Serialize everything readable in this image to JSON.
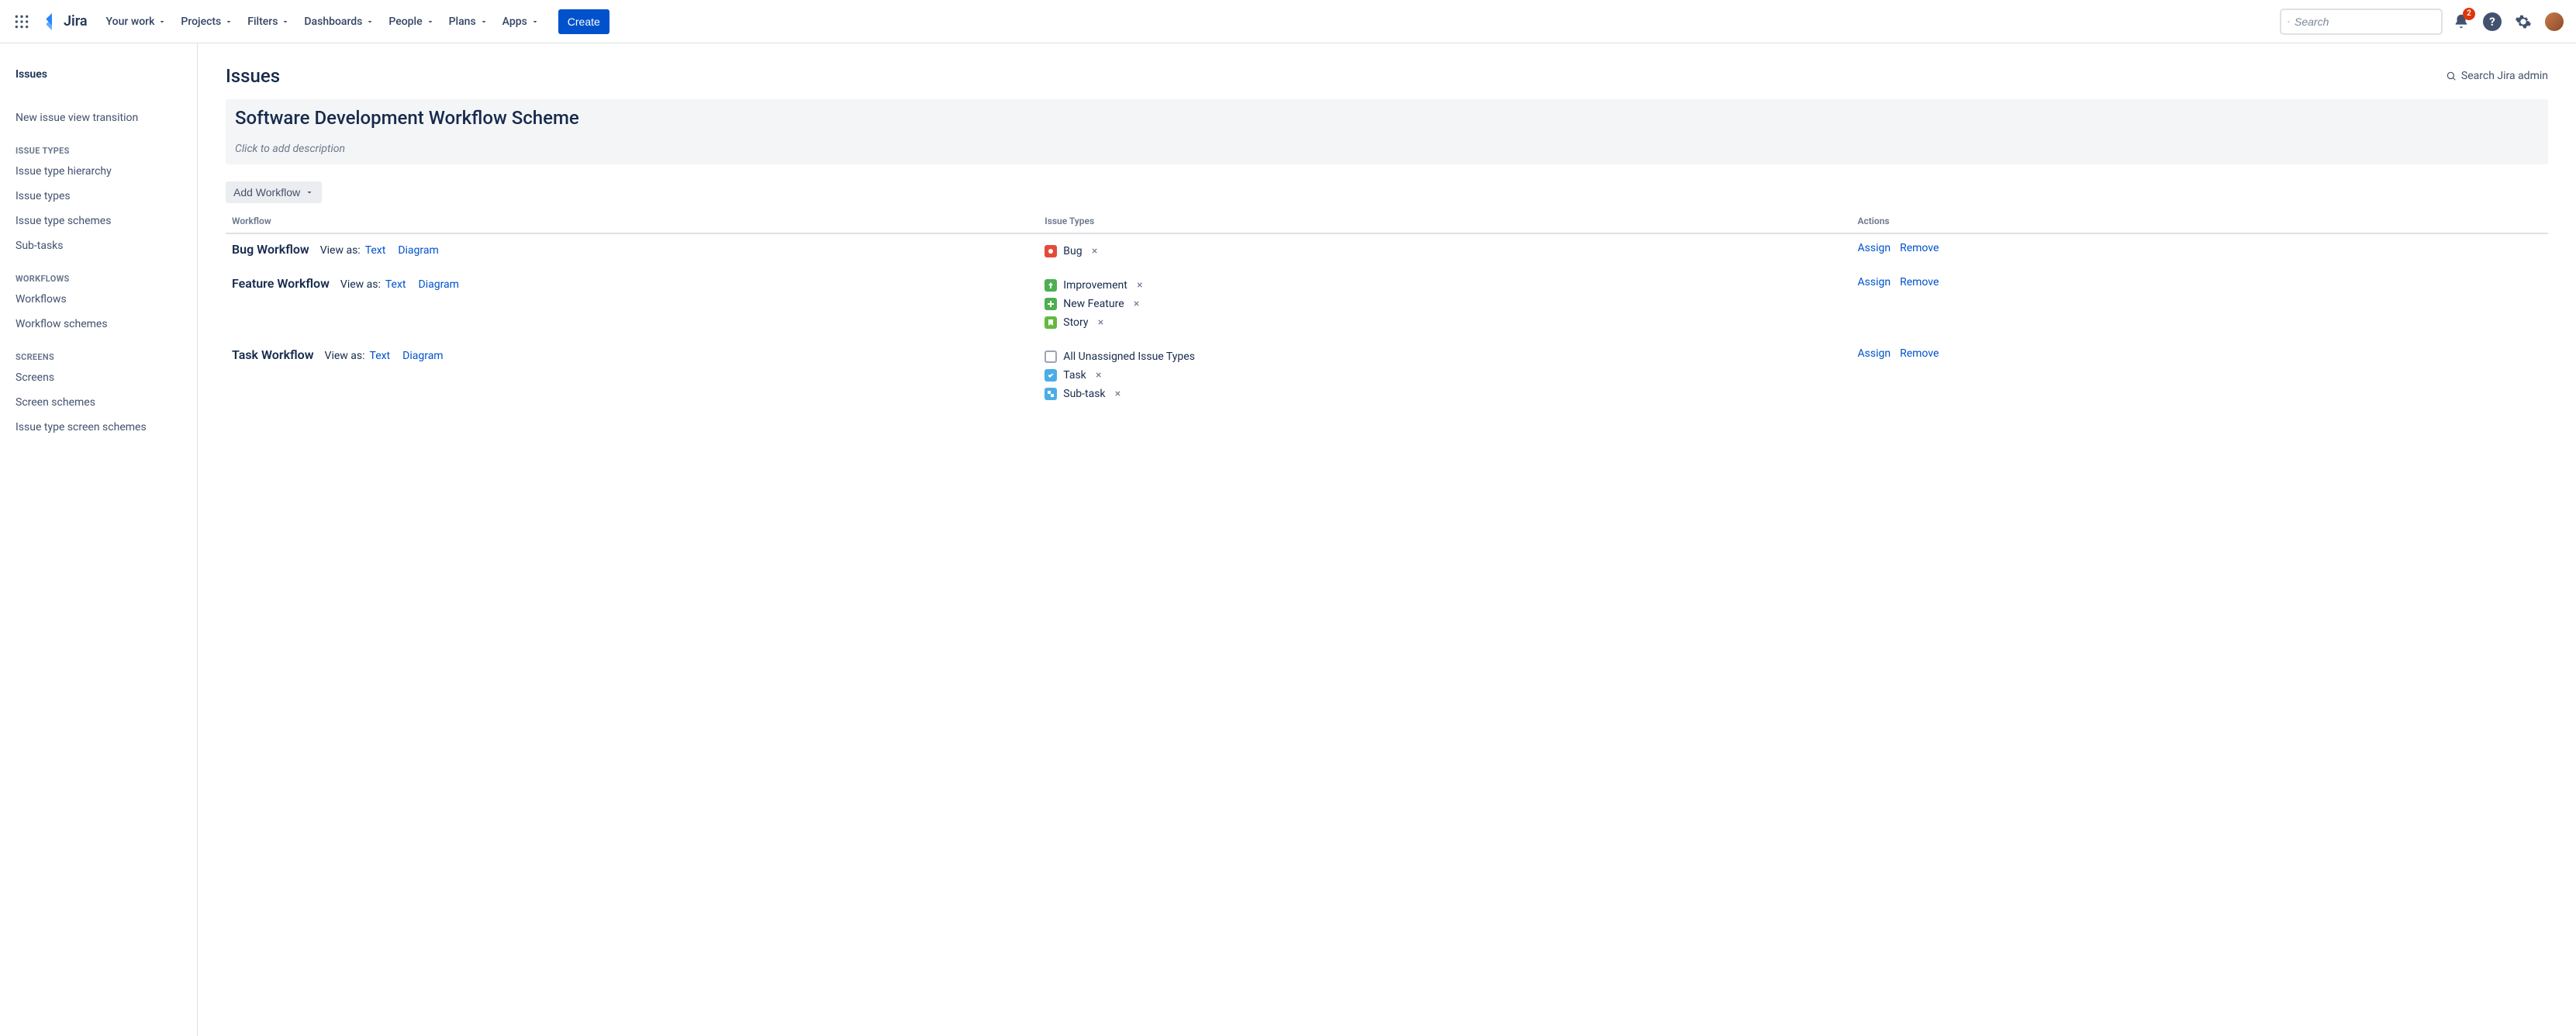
{
  "nav": {
    "product": "Jira",
    "items": [
      "Your work",
      "Projects",
      "Filters",
      "Dashboards",
      "People",
      "Plans",
      "Apps"
    ],
    "create": "Create",
    "search_placeholder": "Search",
    "notification_count": "2"
  },
  "sidebar": {
    "title": "Issues",
    "top_links": [
      "New issue view transition"
    ],
    "groups": [
      {
        "label": "ISSUE TYPES",
        "items": [
          "Issue type hierarchy",
          "Issue types",
          "Issue type schemes",
          "Sub-tasks"
        ]
      },
      {
        "label": "WORKFLOWS",
        "items": [
          "Workflows",
          "Workflow schemes"
        ]
      },
      {
        "label": "SCREENS",
        "items": [
          "Screens",
          "Screen schemes",
          "Issue type screen schemes"
        ]
      }
    ]
  },
  "page": {
    "title": "Issues",
    "admin_search": "Search Jira admin",
    "scheme_title": "Software Development Workflow Scheme",
    "scheme_desc_placeholder": "Click to add description",
    "add_workflow": "Add Workflow",
    "columns": {
      "workflow": "Workflow",
      "issue_types": "Issue Types",
      "actions": "Actions"
    },
    "view_as": "View as:",
    "view_text": "Text",
    "view_diagram": "Diagram",
    "assign": "Assign",
    "remove": "Remove",
    "rows": [
      {
        "name": "Bug Workflow",
        "types": [
          {
            "icon": "bug",
            "label": "Bug",
            "removable": true
          }
        ]
      },
      {
        "name": "Feature Workflow",
        "types": [
          {
            "icon": "improvement",
            "label": "Improvement",
            "removable": true
          },
          {
            "icon": "newfeature",
            "label": "New Feature",
            "removable": true
          },
          {
            "icon": "story",
            "label": "Story",
            "removable": true
          }
        ]
      },
      {
        "name": "Task Workflow",
        "types": [
          {
            "icon": "unassigned",
            "label": "All Unassigned Issue Types",
            "removable": false
          },
          {
            "icon": "task",
            "label": "Task",
            "removable": true
          },
          {
            "icon": "subtask",
            "label": "Sub-task",
            "removable": true
          }
        ]
      }
    ]
  }
}
